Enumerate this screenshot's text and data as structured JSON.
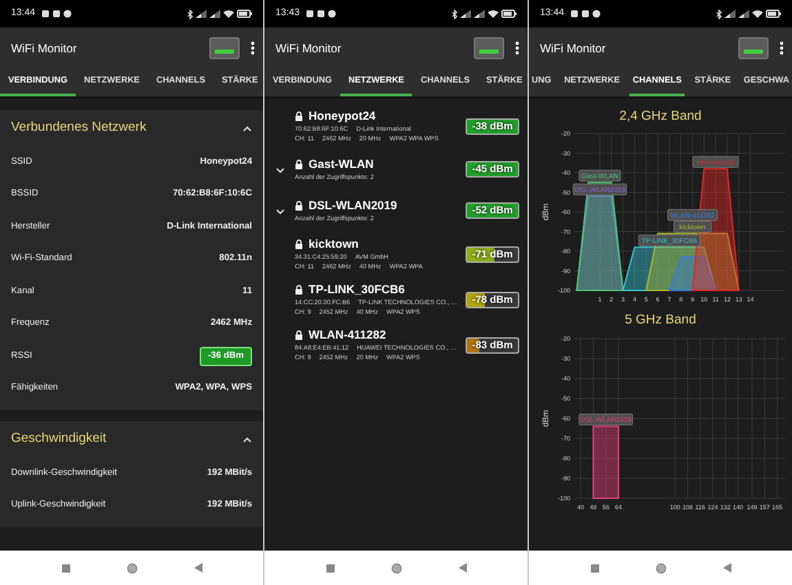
{
  "phones": [
    {
      "kind": "connection",
      "status_bar": {
        "time": "13:44"
      },
      "app_bar": {
        "title": "WiFi Monitor"
      },
      "tabs": [
        {
          "label": "VERBINDUNG",
          "selected": true
        },
        {
          "label": "NETZWERKE",
          "selected": false
        },
        {
          "label": "CHANNELS",
          "selected": false
        },
        {
          "label": "STÄRKE",
          "selected": false
        }
      ],
      "sections": [
        {
          "title": "Verbundenes Netzwerk",
          "expanded": true,
          "rows": [
            {
              "kind": "text",
              "label": "SSID",
              "value": "Honeypot24"
            },
            {
              "kind": "text",
              "label": "BSSID",
              "value": "70:62:B8:6F:10:6C"
            },
            {
              "kind": "text",
              "label": "Hersteller",
              "value": "D-Link International"
            },
            {
              "kind": "text",
              "label": "Wi-Fi-Standard",
              "value": "802.11n"
            },
            {
              "kind": "text",
              "label": "Kanal",
              "value": "11"
            },
            {
              "kind": "text",
              "label": "Frequenz",
              "value": "2462 MHz"
            },
            {
              "kind": "badge",
              "label": "RSSI",
              "value": "-36 dBm",
              "color": "#1f9a26"
            },
            {
              "kind": "text",
              "label": "Fähigkeiten",
              "value": "WPA2, WPA, WPS"
            }
          ]
        },
        {
          "title": "Geschwindigkeit",
          "expanded": true,
          "rows": [
            {
              "kind": "text",
              "label": "Downlink-Geschwindigkeit",
              "value": "192 MBit/s"
            },
            {
              "kind": "text",
              "label": "Uplink-Geschwindigkeit",
              "value": "192 MBit/s"
            }
          ]
        }
      ]
    },
    {
      "kind": "networks",
      "status_bar": {
        "time": "13:43"
      },
      "app_bar": {
        "title": "WiFi Monitor"
      },
      "tabs": [
        {
          "label": "VERBINDUNG",
          "selected": false
        },
        {
          "label": "NETZWERKE",
          "selected": true
        },
        {
          "label": "CHANNELS",
          "selected": false
        },
        {
          "label": "STÄRKE",
          "selected": false
        }
      ],
      "networks": [
        {
          "kind": "network",
          "name": "Honeypot24",
          "bssid": "70:62:B8:6F:10:6C",
          "vendor": "D-Link International",
          "channel": "CH: 11",
          "frequency": "2462 MHz",
          "width": "20 MHz",
          "security": "WPA2 WPA WPS",
          "rssi": "-38 dBm",
          "level": 1,
          "color": "#22a02a"
        },
        {
          "kind": "group",
          "name": "Gast-WLAN",
          "expanded": false,
          "info": "Anzahl der Zugriffspunkte: 2",
          "rssi": "-45 dBm",
          "level": 1,
          "color": "#22a02a"
        },
        {
          "kind": "group",
          "name": "DSL-WLAN2019",
          "expanded": false,
          "info": "Anzahl der Zugriffspunkte: 2",
          "rssi": "-52 dBm",
          "level": 1,
          "color": "#22a02a"
        },
        {
          "kind": "network",
          "name": "kicktown",
          "bssid": "34:31:C4:25:59:20",
          "vendor": "AVM GmbH",
          "channel": "CH: 11",
          "frequency": "2462 MHz",
          "width": "40 MHz",
          "security": "WPA2 WPA",
          "rssi": "-71 dBm",
          "level": 0.55,
          "color": "#8fae1a"
        },
        {
          "kind": "network",
          "name": "TP-LINK_30FCB6",
          "bssid": "14:CC:20:30:FC:B6",
          "vendor": "TP-LINK TECHNOLOGIES CO., …",
          "channel": "CH: 9",
          "frequency": "2452 MHz",
          "width": "40 MHz",
          "security": "WPA2 WPS",
          "rssi": "-78 dBm",
          "level": 0.35,
          "color": "#b3a40e"
        },
        {
          "kind": "network",
          "name": "WLAN-411282",
          "bssid": "84:A8:E4:EB:41:12",
          "vendor": "HUAWEI TECHNOLOGIES CO., …",
          "channel": "CH: 9",
          "frequency": "2452 MHz",
          "width": "20 MHz",
          "security": "WPA2 WPS",
          "rssi": "-83 dBm",
          "level": 0.25,
          "color": "#b07410"
        }
      ]
    },
    {
      "kind": "channels",
      "status_bar": {
        "time": "13:44"
      },
      "app_bar": {
        "title": "WiFi Monitor"
      },
      "tabs": [
        {
          "label": "UNG",
          "selected": false
        },
        {
          "label": "NETZWERKE",
          "selected": false
        },
        {
          "label": "CHANNELS",
          "selected": true
        },
        {
          "label": "STÄRKE",
          "selected": false
        },
        {
          "label": "GESCHWA",
          "selected": false
        }
      ],
      "charts": [
        {
          "chart_data": {
            "type": "area",
            "title": "2,4 GHz Band",
            "ylabel": "dBm",
            "grid": true,
            "ylim": [
              -100,
              -20
            ],
            "xlim": [
              -1.2,
              17
            ],
            "yticks": [
              -20,
              -30,
              -40,
              -50,
              -60,
              -70,
              -80,
              -90,
              -100
            ],
            "xticks": [
              1,
              2,
              3,
              4,
              5,
              6,
              7,
              8,
              9,
              10,
              11,
              12,
              13,
              14
            ],
            "x": [
              -1,
              0,
              1,
              2,
              3,
              4,
              5,
              6,
              7,
              8,
              9,
              10,
              11,
              12,
              13
            ],
            "series": [
              {
                "name": "DSL-WLAN2019",
                "color": "#8a5ad8",
                "values": [
                  -100,
                  -52,
                  -52,
                  -52,
                  -100,
                  null,
                  null,
                  null,
                  null,
                  null,
                  null,
                  null,
                  null,
                  null,
                  null
                ]
              },
              {
                "name": "Gast-WLAN",
                "color": "#4cc47a",
                "values": [
                  -100,
                  -45,
                  -45,
                  -45,
                  -100,
                  null,
                  null,
                  null,
                  null,
                  null,
                  null,
                  null,
                  null,
                  null,
                  null
                ]
              },
              {
                "name": "TP-LINK_30FCB6",
                "color": "#36c0d0",
                "values": [
                  null,
                  null,
                  null,
                  null,
                  -100,
                  -78,
                  -78,
                  -78,
                  -78,
                  -78,
                  -78,
                  -78,
                  -100,
                  null,
                  null
                ]
              },
              {
                "name": "kicktown",
                "color": "#a8b830",
                "values": [
                  null,
                  null,
                  null,
                  null,
                  null,
                  null,
                  -100,
                  -71,
                  -71,
                  -71,
                  -71,
                  -71,
                  -71,
                  -71,
                  -100
                ]
              },
              {
                "name": "WLAN-411282",
                "color": "#3a7ad8",
                "values": [
                  null,
                  null,
                  null,
                  null,
                  null,
                  null,
                  null,
                  null,
                  -100,
                  -83,
                  -83,
                  -83,
                  -100,
                  null,
                  null
                ]
              },
              {
                "name": "Honeypot24",
                "color": "#e02828",
                "values": [
                  null,
                  null,
                  null,
                  null,
                  null,
                  null,
                  null,
                  null,
                  null,
                  null,
                  -100,
                  -38,
                  -38,
                  -38,
                  -100
                ]
              }
            ]
          }
        },
        {
          "chart_data": {
            "type": "area",
            "title": "5 GHz Band",
            "ylabel": "dBm",
            "grid": true,
            "ylim": [
              -100,
              -20
            ],
            "xlim": [
              36,
              170
            ],
            "yticks": [
              -20,
              -30,
              -40,
              -50,
              -60,
              -70,
              -80,
              -90,
              -100
            ],
            "xticks": [
              40,
              48,
              56,
              64,
              100,
              108,
              116,
              124,
              132,
              140,
              149,
              157,
              165
            ],
            "x": [
              48,
              48,
              64,
              64
            ],
            "series": [
              {
                "name": "DSL-WLAN2019",
                "color": "#e0407a",
                "values": [
                  -100,
                  -64,
                  -64,
                  -100
                ]
              }
            ]
          }
        }
      ]
    }
  ]
}
